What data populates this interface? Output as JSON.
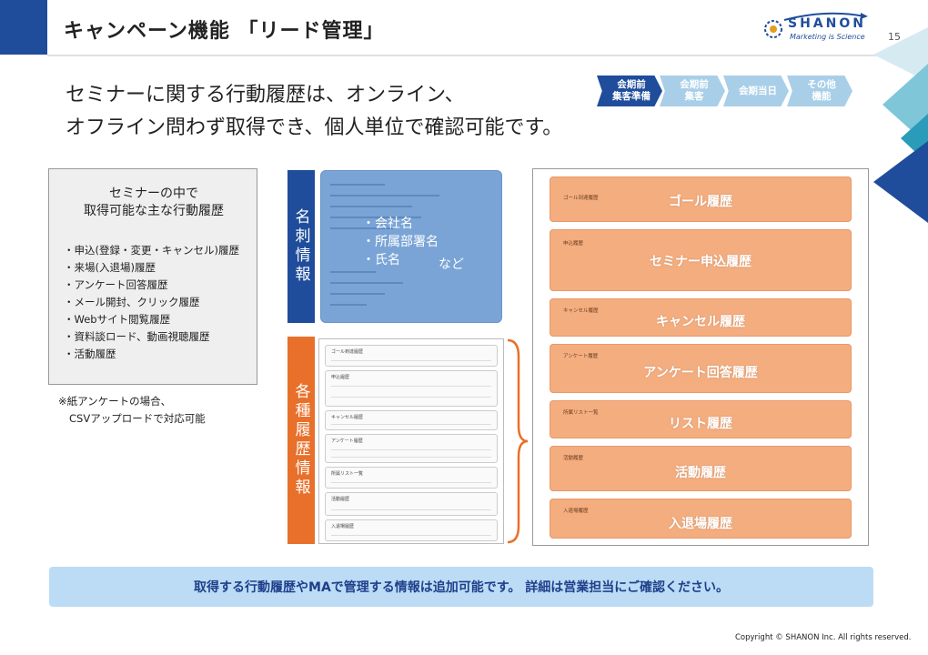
{
  "header": {
    "title": "キャンペーン機能 「リード管理」",
    "logo_word": "SHANON",
    "logo_tagline": "Marketing is Science",
    "page_number": "15"
  },
  "lead": {
    "line1": "セミナーに関する行動履歴は、オンライン、",
    "line2": "オフライン問わず取得でき、個人単位で確認可能です。"
  },
  "phases": [
    {
      "label": "会期前\n集客準備",
      "active": true
    },
    {
      "label": "会期前\n集客",
      "active": false
    },
    {
      "label": "会期当日",
      "active": false
    },
    {
      "label": "その他\n機能",
      "active": false
    }
  ],
  "left_box": {
    "title_line1": "セミナーの中で",
    "title_line2": "取得可能な主な行動履歴",
    "items": [
      "申込(登録・変更・キャンセル)履歴",
      "来場(入退場)履歴",
      "アンケート回答履歴",
      "メール開封、クリック履歴",
      "Webサイト閲覧履歴",
      "資料談ロード、動画視聴履歴",
      "活動履歴"
    ],
    "note_line1": "※紙アンケートの場合、",
    "note_line2": "CSVアップロードで対応可能"
  },
  "card_section": {
    "vertical_label": "名刺情報",
    "items": [
      "・会社名",
      "・所属部署名",
      "・氏名"
    ],
    "etc": "など"
  },
  "history_section": {
    "vertical_label": "各種履歴情報",
    "thumb_titles": [
      "ゴール到達履歴",
      "申込履歴",
      "キャンセル履歴",
      "アンケート履歴",
      "所属リスト一覧",
      "活動履歴",
      "入退場履歴"
    ]
  },
  "history_bars": [
    {
      "label": "ゴール履歴",
      "sub": "ゴール到達履歴"
    },
    {
      "label": "セミナー申込履歴",
      "sub": "申込履歴"
    },
    {
      "label": "キャンセル履歴",
      "sub": "キャンセル履歴"
    },
    {
      "label": "アンケート回答履歴",
      "sub": "アンケート履歴"
    },
    {
      "label": "リスト履歴",
      "sub": "所属リスト一覧"
    },
    {
      "label": "活動履歴",
      "sub": "活動履歴"
    },
    {
      "label": "入退場履歴",
      "sub": "入退場履歴"
    }
  ],
  "banner": "取得する行動履歴やMAで管理する情報は追加可能です。 詳細は営業担当にご確認ください。",
  "copyright": "Copyright © SHANON Inc. All rights reserved."
}
